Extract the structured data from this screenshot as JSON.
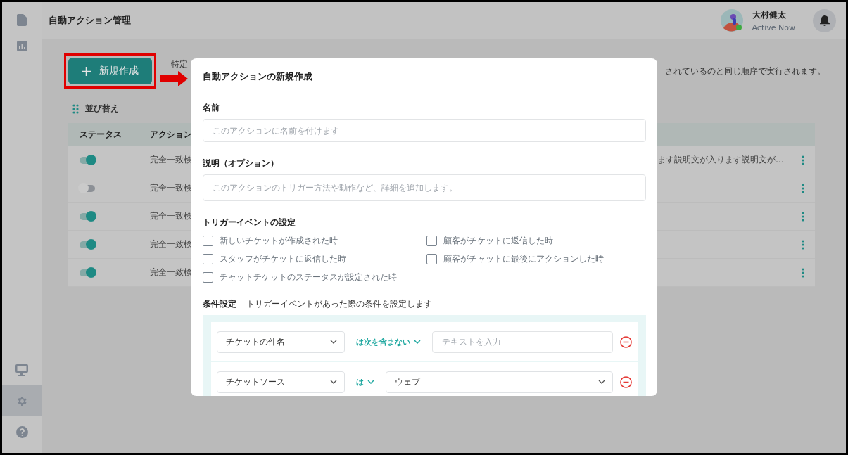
{
  "header": {
    "title": "自動アクション管理",
    "user": {
      "name": "大村健太",
      "status": "Active Now"
    }
  },
  "sidebar": {
    "top": [
      {
        "selected": false
      },
      {
        "selected": false
      }
    ],
    "bottom": [
      {
        "selected": false
      },
      {
        "selected": true
      },
      {
        "selected": false
      }
    ]
  },
  "toolbar": {
    "new_button": "新規作成",
    "description_start": "特定",
    "description_end": "されているのと同じ順序で実行されます。",
    "sort_label": "並び替え"
  },
  "table": {
    "columns": [
      "ステータス",
      "アクション"
    ],
    "rows": [
      {
        "on": true,
        "action": "完全一致検",
        "description": "ます説明文が入ります説明文が…"
      },
      {
        "on": false,
        "action": "完全一致検"
      },
      {
        "on": true,
        "action": "完全一致検"
      },
      {
        "on": true,
        "action": "完全一致検"
      },
      {
        "on": true,
        "action": "完全一致検"
      }
    ]
  },
  "modal": {
    "title": "自動アクションの新規作成",
    "name": {
      "label": "名前",
      "placeholder": "このアクションに名前を付けます"
    },
    "description": {
      "label": "説明（オプション）",
      "placeholder": "このアクションのトリガー方法や動作など、詳細を追加します。"
    },
    "triggers": {
      "title": "トリガーイベントの設定",
      "options": [
        {
          "label": "新しいチケットが作成された時",
          "checked": false
        },
        {
          "label": "顧客がチケットに返信した時",
          "checked": false
        },
        {
          "label": "スタッフがチケットに返信した時",
          "checked": false
        },
        {
          "label": "顧客がチャットに最後にアクションした時",
          "checked": false
        },
        {
          "label": "チャットチケットのステータスが設定された時",
          "checked": false
        }
      ]
    },
    "conditions": {
      "title": "条件設定",
      "hint": "トリガーイベントがあった際の条件を設定します",
      "rows": [
        {
          "field": "チケットの件名",
          "operator": "は次を含まない",
          "kind": "input",
          "placeholder": "テキストを入力"
        },
        {
          "field": "チケットソース",
          "operator": "は",
          "kind": "select",
          "value": "ウェブ"
        }
      ]
    }
  }
}
